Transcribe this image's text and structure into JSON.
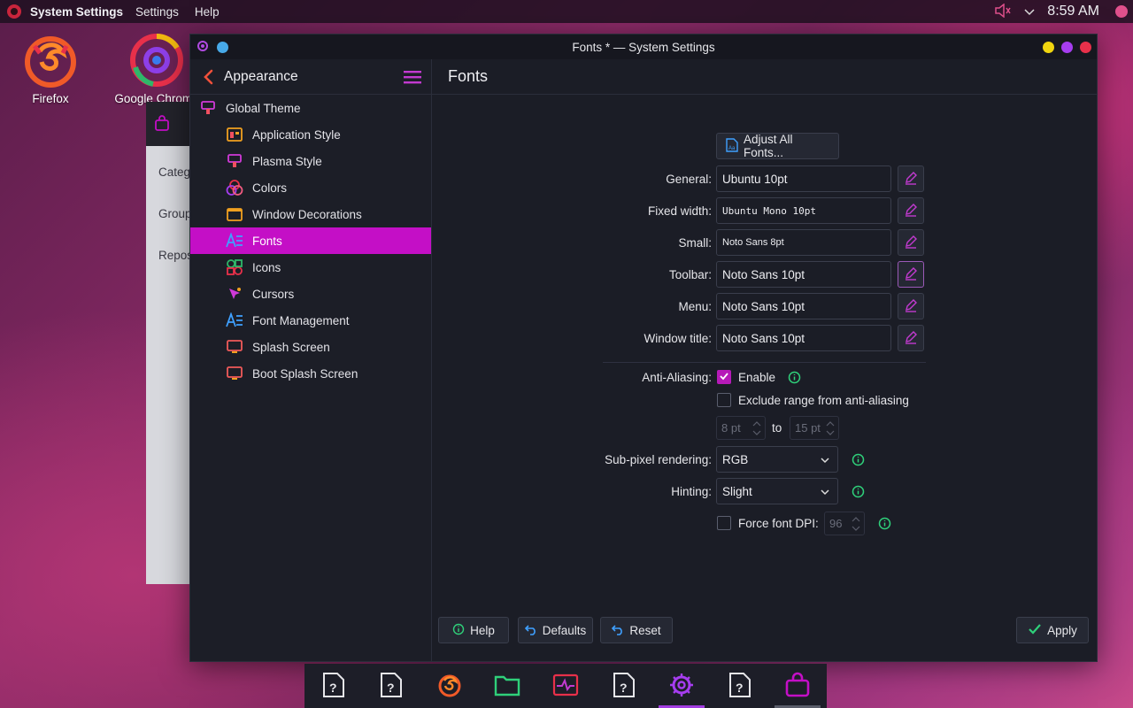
{
  "top_panel": {
    "app_name": "System Settings",
    "menus": [
      "Settings",
      "Help"
    ],
    "clock": "8:59 AM"
  },
  "desktop": {
    "icons": [
      {
        "label": "Firefox"
      },
      {
        "label": "Google Chrome"
      }
    ]
  },
  "bg_window": {
    "items": [
      "Categ",
      "Group",
      "Repos"
    ]
  },
  "window": {
    "title": "Fonts * — System Settings",
    "colors": {
      "yellow": "#f0d50f",
      "purple": "#a63df0",
      "red": "#e8304a",
      "blue": "#47a9e8",
      "accent": "#c40fc6"
    }
  },
  "sidebar": {
    "title": "Appearance",
    "items": [
      {
        "label": "Global Theme",
        "icon": "global-theme-icon"
      },
      {
        "label": "Application Style",
        "icon": "application-style-icon"
      },
      {
        "label": "Plasma Style",
        "icon": "plasma-style-icon"
      },
      {
        "label": "Colors",
        "icon": "colors-icon"
      },
      {
        "label": "Window Decorations",
        "icon": "window-decorations-icon"
      },
      {
        "label": "Fonts",
        "icon": "fonts-icon",
        "active": true
      },
      {
        "label": "Icons",
        "icon": "icons-icon"
      },
      {
        "label": "Cursors",
        "icon": "cursors-icon"
      },
      {
        "label": "Font Management",
        "icon": "font-management-icon"
      },
      {
        "label": "Splash Screen",
        "icon": "splash-screen-icon"
      },
      {
        "label": "Boot Splash Screen",
        "icon": "boot-splash-screen-icon"
      }
    ]
  },
  "content": {
    "title": "Fonts",
    "adjust_all": "Adjust All Fonts...",
    "fonts": [
      {
        "label": "General:",
        "value": "Ubuntu 10pt"
      },
      {
        "label": "Fixed width:",
        "value": "Ubuntu Mono 10pt"
      },
      {
        "label": "Small:",
        "value": "Noto Sans 8pt"
      },
      {
        "label": "Toolbar:",
        "value": "Noto Sans 10pt"
      },
      {
        "label": "Menu:",
        "value": "Noto Sans 10pt"
      },
      {
        "label": "Window title:",
        "value": "Noto Sans 10pt"
      }
    ],
    "antialiasing": {
      "label": "Anti-Aliasing:",
      "enable_label": "Enable",
      "enable_checked": true,
      "exclude_label": "Exclude range from anti-aliasing",
      "exclude_checked": false,
      "range_from": "8 pt",
      "range_to_label": "to",
      "range_to": "15 pt"
    },
    "subpixel": {
      "label": "Sub-pixel rendering:",
      "value": "RGB"
    },
    "hinting": {
      "label": "Hinting:",
      "value": "Slight"
    },
    "dpi": {
      "label": "Force font DPI:",
      "value": "96",
      "checked": false
    }
  },
  "footer": {
    "help": "Help",
    "defaults": "Defaults",
    "reset": "Reset",
    "apply": "Apply"
  },
  "taskbar": {
    "items": [
      {
        "icon": "unknown-app-icon"
      },
      {
        "icon": "unknown-app-icon"
      },
      {
        "icon": "firefox-icon"
      },
      {
        "icon": "files-icon"
      },
      {
        "icon": "system-monitor-icon"
      },
      {
        "icon": "unknown-app-icon"
      },
      {
        "icon": "system-settings-icon",
        "active": true
      },
      {
        "icon": "unknown-app-icon"
      },
      {
        "icon": "store-icon",
        "running": true
      }
    ]
  }
}
